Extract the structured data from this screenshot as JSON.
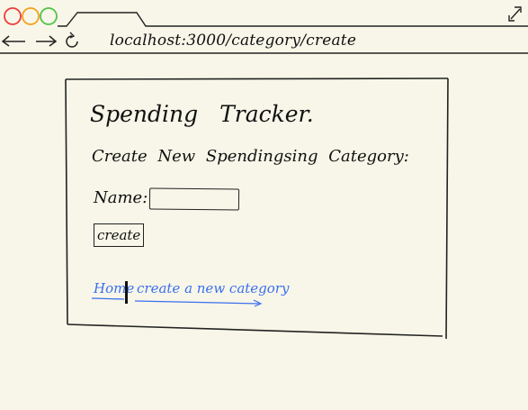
{
  "browser": {
    "url": "localhost:3000/category/create",
    "icons": {
      "close": "red-circle",
      "minimize": "yellow-circle",
      "maximize": "green-circle",
      "back": "arrow-left-icon",
      "forward": "arrow-right-icon",
      "reload": "reload-icon",
      "fullscreen": "expand-diagonal-icon"
    },
    "colors": {
      "close": "#ee3b3b",
      "minimize": "#f2a21b",
      "maximize": "#4fc44a"
    }
  },
  "page": {
    "title": "Spending Tracker.",
    "subtitle": "Create New Spendingsing Category:",
    "form": {
      "name_label": "Name:",
      "name_value": "",
      "submit_label": "create"
    },
    "links": {
      "home": "Home",
      "create_category": "create a new category"
    },
    "colors": {
      "link": "#3b6ff0",
      "background": "#f7f6e8"
    }
  }
}
